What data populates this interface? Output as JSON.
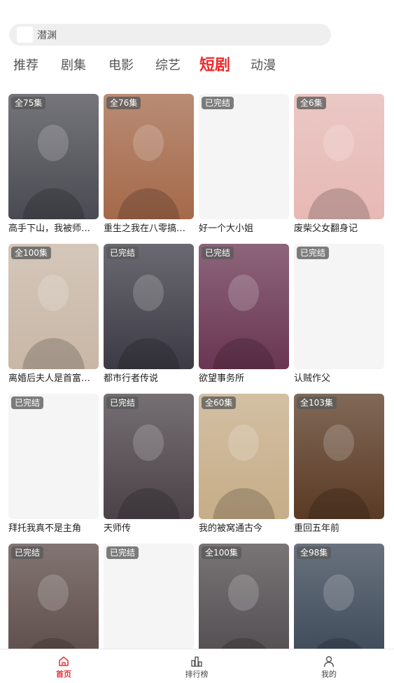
{
  "search": {
    "text": "潜渊"
  },
  "tabs": [
    {
      "label": "推荐",
      "active": false
    },
    {
      "label": "剧集",
      "active": false
    },
    {
      "label": "电影",
      "active": false
    },
    {
      "label": "综艺",
      "active": false
    },
    {
      "label": "短剧",
      "active": true
    },
    {
      "label": "动漫",
      "active": false
    }
  ],
  "items": [
    {
      "badge": "全75集",
      "title": "高手下山，我被师姐...",
      "poster": "#4a4a52"
    },
    {
      "badge": "全76集",
      "title": "重生之我在八零搞纯...",
      "poster": "#a5694a"
    },
    {
      "badge": "已完结",
      "title": "好一个大小姐",
      "poster": ""
    },
    {
      "badge": "全6集",
      "title": "废柴父女翻身记",
      "poster": "#e7b9b5"
    },
    {
      "badge": "全100集",
      "title": "离婚后夫人是首富千...",
      "poster": "#c9b7a6"
    },
    {
      "badge": "已完结",
      "title": "都市行者传说",
      "poster": "#3c3b45"
    },
    {
      "badge": "已完结",
      "title": "欲望事务所",
      "poster": "#6a3552"
    },
    {
      "badge": "已完结",
      "title": "认贼作父",
      "poster": ""
    },
    {
      "badge": "已完结",
      "title": "拜托我真不是主角",
      "poster": ""
    },
    {
      "badge": "已完结",
      "title": "天师传",
      "poster": "#4b4247"
    },
    {
      "badge": "全60集",
      "title": "我的被窝通古今",
      "poster": "#c7ad88"
    },
    {
      "badge": "全103集",
      "title": "重回五年前",
      "poster": "#5a3a24"
    },
    {
      "badge": "已完结",
      "title": "",
      "poster": "#5b4a47"
    },
    {
      "badge": "已完结",
      "title": "",
      "poster": ""
    },
    {
      "badge": "全100集",
      "title": "",
      "poster": "#4f4a4d"
    },
    {
      "badge": "全98集",
      "title": "",
      "poster": "#3a4656"
    }
  ],
  "bottom_nav": [
    {
      "label": "首页",
      "active": true,
      "icon": "home-icon"
    },
    {
      "label": "排行榜",
      "active": false,
      "icon": "chart-icon"
    },
    {
      "label": "我的",
      "active": false,
      "icon": "user-icon"
    }
  ],
  "colors": {
    "accent": "#f02828",
    "placeholder_poster": "#f5f5f5"
  }
}
